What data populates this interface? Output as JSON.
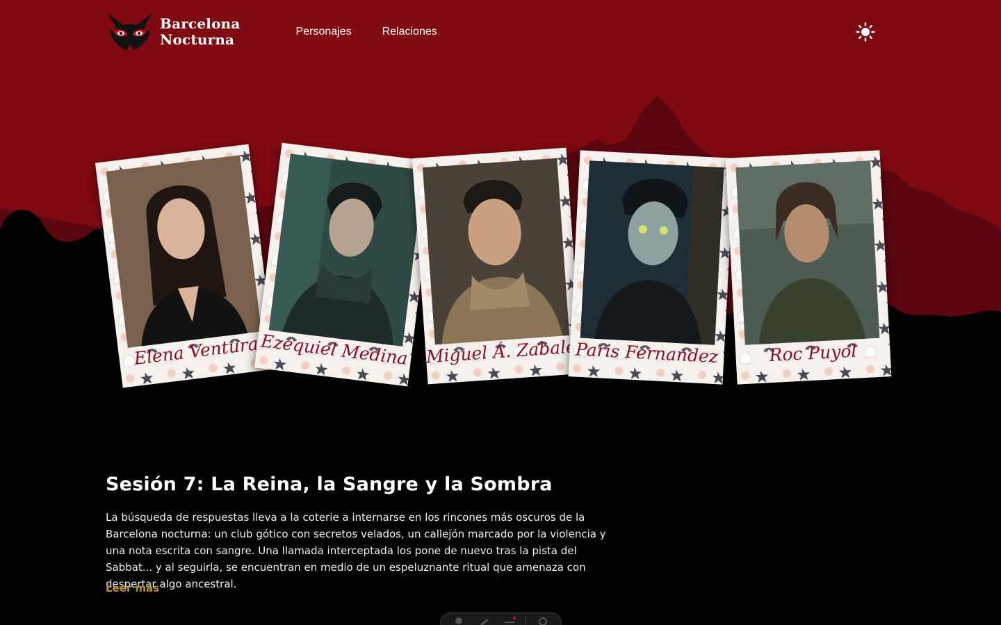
{
  "brand": {
    "line1": "Barcelona",
    "line2": "Nocturna",
    "logo_icon": "mask-icon"
  },
  "nav": {
    "items": [
      {
        "label": "Personajes"
      },
      {
        "label": "Relaciones"
      }
    ]
  },
  "theme_toggle": {
    "icon": "sun-icon"
  },
  "characters": [
    {
      "name": "Elena Ventura"
    },
    {
      "name": "Ezequiel Medina"
    },
    {
      "name": "Miguel Á. Zabaleta"
    },
    {
      "name": "Paris Fernandez"
    },
    {
      "name": "Roc Puyol"
    }
  ],
  "session": {
    "title": "Sesión 7: La Reina, la Sangre y la Sombra",
    "description": "La búsqueda de respuestas lleva a la coterie a internarse en los rincones más oscuros de la Barcelona nocturna: un club gótico con secretos velados, un callejón marcado por la violencia y una nota escrita con sangre. Una llamada interceptada los pone de nuevo tras la pista del Sabbat... y al seguirla, se encuentran en medio de un espeluznante ritual que amenaza con despertar algo ancestral.",
    "read_more": "Leer más"
  },
  "toolbar": {
    "icons": [
      "pointer-icon",
      "pen-icon",
      "menu-icon",
      "gear-icon"
    ]
  },
  "colors": {
    "hero_red": "#800a12",
    "dark_red": "#5c0710",
    "accent_gold": "#b8902e",
    "card_name": "#8b0e25"
  }
}
